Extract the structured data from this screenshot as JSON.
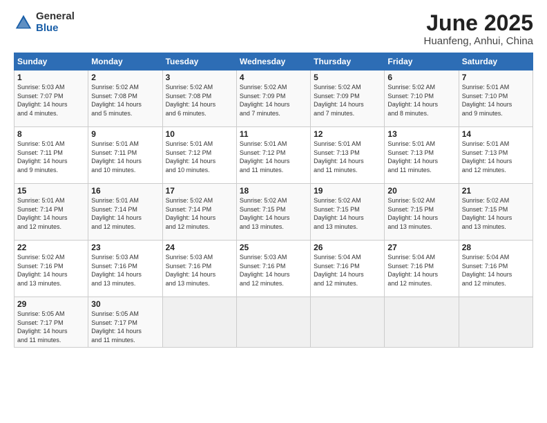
{
  "logo": {
    "general": "General",
    "blue": "Blue"
  },
  "title": "June 2025",
  "location": "Huanfeng, Anhui, China",
  "weekdays": [
    "Sunday",
    "Monday",
    "Tuesday",
    "Wednesday",
    "Thursday",
    "Friday",
    "Saturday"
  ],
  "weeks": [
    [
      {
        "day": "1",
        "info": "Sunrise: 5:03 AM\nSunset: 7:07 PM\nDaylight: 14 hours\nand 4 minutes."
      },
      {
        "day": "2",
        "info": "Sunrise: 5:02 AM\nSunset: 7:08 PM\nDaylight: 14 hours\nand 5 minutes."
      },
      {
        "day": "3",
        "info": "Sunrise: 5:02 AM\nSunset: 7:08 PM\nDaylight: 14 hours\nand 6 minutes."
      },
      {
        "day": "4",
        "info": "Sunrise: 5:02 AM\nSunset: 7:09 PM\nDaylight: 14 hours\nand 7 minutes."
      },
      {
        "day": "5",
        "info": "Sunrise: 5:02 AM\nSunset: 7:09 PM\nDaylight: 14 hours\nand 7 minutes."
      },
      {
        "day": "6",
        "info": "Sunrise: 5:02 AM\nSunset: 7:10 PM\nDaylight: 14 hours\nand 8 minutes."
      },
      {
        "day": "7",
        "info": "Sunrise: 5:01 AM\nSunset: 7:10 PM\nDaylight: 14 hours\nand 9 minutes."
      }
    ],
    [
      {
        "day": "8",
        "info": "Sunrise: 5:01 AM\nSunset: 7:11 PM\nDaylight: 14 hours\nand 9 minutes."
      },
      {
        "day": "9",
        "info": "Sunrise: 5:01 AM\nSunset: 7:11 PM\nDaylight: 14 hours\nand 10 minutes."
      },
      {
        "day": "10",
        "info": "Sunrise: 5:01 AM\nSunset: 7:12 PM\nDaylight: 14 hours\nand 10 minutes."
      },
      {
        "day": "11",
        "info": "Sunrise: 5:01 AM\nSunset: 7:12 PM\nDaylight: 14 hours\nand 11 minutes."
      },
      {
        "day": "12",
        "info": "Sunrise: 5:01 AM\nSunset: 7:13 PM\nDaylight: 14 hours\nand 11 minutes."
      },
      {
        "day": "13",
        "info": "Sunrise: 5:01 AM\nSunset: 7:13 PM\nDaylight: 14 hours\nand 11 minutes."
      },
      {
        "day": "14",
        "info": "Sunrise: 5:01 AM\nSunset: 7:13 PM\nDaylight: 14 hours\nand 12 minutes."
      }
    ],
    [
      {
        "day": "15",
        "info": "Sunrise: 5:01 AM\nSunset: 7:14 PM\nDaylight: 14 hours\nand 12 minutes."
      },
      {
        "day": "16",
        "info": "Sunrise: 5:01 AM\nSunset: 7:14 PM\nDaylight: 14 hours\nand 12 minutes."
      },
      {
        "day": "17",
        "info": "Sunrise: 5:02 AM\nSunset: 7:14 PM\nDaylight: 14 hours\nand 12 minutes."
      },
      {
        "day": "18",
        "info": "Sunrise: 5:02 AM\nSunset: 7:15 PM\nDaylight: 14 hours\nand 13 minutes."
      },
      {
        "day": "19",
        "info": "Sunrise: 5:02 AM\nSunset: 7:15 PM\nDaylight: 14 hours\nand 13 minutes."
      },
      {
        "day": "20",
        "info": "Sunrise: 5:02 AM\nSunset: 7:15 PM\nDaylight: 14 hours\nand 13 minutes."
      },
      {
        "day": "21",
        "info": "Sunrise: 5:02 AM\nSunset: 7:15 PM\nDaylight: 14 hours\nand 13 minutes."
      }
    ],
    [
      {
        "day": "22",
        "info": "Sunrise: 5:02 AM\nSunset: 7:16 PM\nDaylight: 14 hours\nand 13 minutes."
      },
      {
        "day": "23",
        "info": "Sunrise: 5:03 AM\nSunset: 7:16 PM\nDaylight: 14 hours\nand 13 minutes."
      },
      {
        "day": "24",
        "info": "Sunrise: 5:03 AM\nSunset: 7:16 PM\nDaylight: 14 hours\nand 13 minutes."
      },
      {
        "day": "25",
        "info": "Sunrise: 5:03 AM\nSunset: 7:16 PM\nDaylight: 14 hours\nand 12 minutes."
      },
      {
        "day": "26",
        "info": "Sunrise: 5:04 AM\nSunset: 7:16 PM\nDaylight: 14 hours\nand 12 minutes."
      },
      {
        "day": "27",
        "info": "Sunrise: 5:04 AM\nSunset: 7:16 PM\nDaylight: 14 hours\nand 12 minutes."
      },
      {
        "day": "28",
        "info": "Sunrise: 5:04 AM\nSunset: 7:16 PM\nDaylight: 14 hours\nand 12 minutes."
      }
    ],
    [
      {
        "day": "29",
        "info": "Sunrise: 5:05 AM\nSunset: 7:17 PM\nDaylight: 14 hours\nand 11 minutes."
      },
      {
        "day": "30",
        "info": "Sunrise: 5:05 AM\nSunset: 7:17 PM\nDaylight: 14 hours\nand 11 minutes."
      },
      {
        "day": "",
        "info": ""
      },
      {
        "day": "",
        "info": ""
      },
      {
        "day": "",
        "info": ""
      },
      {
        "day": "",
        "info": ""
      },
      {
        "day": "",
        "info": ""
      }
    ]
  ]
}
